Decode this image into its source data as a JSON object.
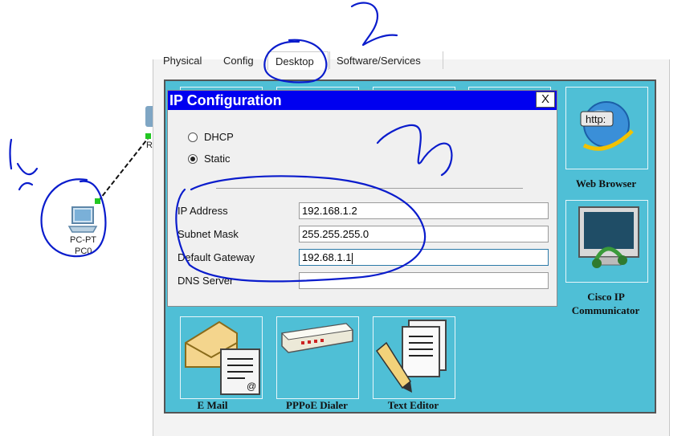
{
  "annotations": {
    "mark_1": "1",
    "mark_2": "2",
    "mark_3": "3"
  },
  "topology": {
    "pc": {
      "type_label": "PC-PT",
      "name_label": "PC0"
    },
    "router_label": "Ro"
  },
  "window": {
    "tabs": [
      {
        "label": "Physical"
      },
      {
        "label": "Config"
      },
      {
        "label": "Desktop",
        "active": true
      },
      {
        "label": "Software/Services"
      }
    ]
  },
  "ip_config": {
    "title": "IP Configuration",
    "close_label": "X",
    "mode": {
      "dhcp_label": "DHCP",
      "static_label": "Static",
      "selected": "static"
    },
    "fields": {
      "ip_label": "IP Address",
      "ip_value": "192.168.1.2",
      "mask_label": "Subnet Mask",
      "mask_value": "255.255.255.0",
      "gateway_label": "Default Gateway",
      "gateway_value": "192.68.1.1",
      "dns_label": "DNS Server",
      "dns_value": ""
    }
  },
  "apps": {
    "web_browser": "Web Browser",
    "cisco_ip_1": "Cisco IP",
    "cisco_ip_2": "Communicator",
    "email": "E Mail",
    "pppoe": "PPPoE Dialer",
    "text_editor": "Text Editor",
    "web_browser_icon_text": "http:"
  },
  "colors": {
    "titlebar": "#0000f0",
    "desktop_bg": "#4fbfd6",
    "annotation": "#0a1ccc"
  }
}
